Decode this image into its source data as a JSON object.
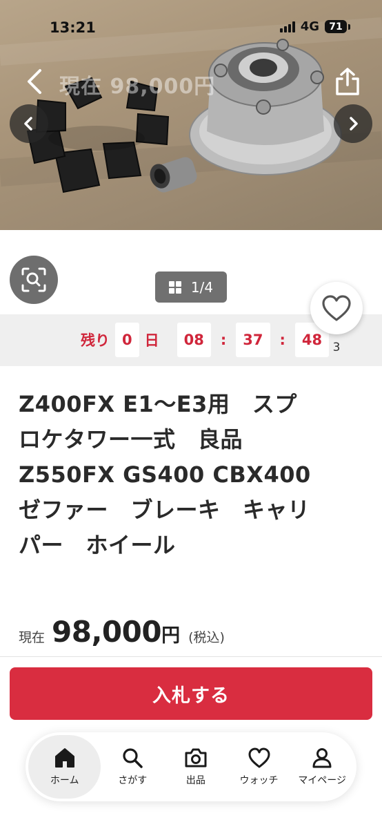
{
  "status_bar": {
    "time": "13:21",
    "network": "4G",
    "battery": "71"
  },
  "photo": {
    "ghost_price": "現在 98,000円",
    "counter": "1/4"
  },
  "icons": {
    "back": "chevron-left-icon",
    "share": "share-icon",
    "prev": "chevron-left-icon",
    "next": "chevron-right-icon",
    "lens": "image-search-icon",
    "watch": "heart-icon"
  },
  "countdown": {
    "prefix": "残り",
    "days": "0",
    "days_unit": "日",
    "hours": "08",
    "minutes": "37",
    "seconds": "48",
    "separator": ":"
  },
  "watch_count": "3",
  "title": "Z400FX E1〜E3用　スプロケタワー一式　良品 Z550FX GS400 CBX400　ゼファー　ブレーキ　キャリパー　ホイール",
  "price": {
    "label": "現在",
    "value": "98,000",
    "unit": "円",
    "tax": "(税込)"
  },
  "bid_button": "入札する",
  "tabs": [
    {
      "label": "ホーム",
      "icon": "home-icon",
      "active": true
    },
    {
      "label": "さがす",
      "icon": "search-icon",
      "active": false
    },
    {
      "label": "出品",
      "icon": "camera-icon",
      "active": false
    },
    {
      "label": "ウォッチ",
      "icon": "heart-icon",
      "active": false
    },
    {
      "label": "マイページ",
      "icon": "person-icon",
      "active": false
    }
  ],
  "colors": {
    "accent": "#d92d40",
    "countdown": "#d0263b",
    "band": "#efefef"
  }
}
